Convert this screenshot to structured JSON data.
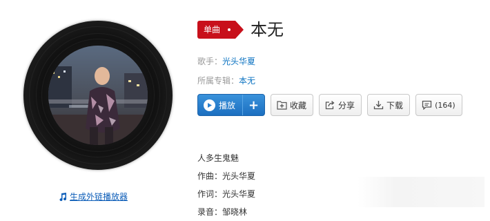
{
  "song": {
    "type_tag": "单曲",
    "title": "本无",
    "artist_label": "歌手：",
    "artist": "光头华夏",
    "album_label": "所属专辑：",
    "album": "本无"
  },
  "actions": {
    "play_label": "播放",
    "add_label": "+",
    "collect_label": "收藏",
    "share_label": "分享",
    "download_label": "下载",
    "comment_count": "(164)"
  },
  "cover": {
    "outlink_label": "生成外链播放器"
  },
  "lyrics": [
    "人多生鬼魅",
    "作曲：光头华夏",
    "作词：光头华夏",
    "录音：邹晓林"
  ],
  "colors": {
    "accent_red": "#c8101b",
    "link_blue": "#0c73c2",
    "play_blue": "#2a80cf"
  },
  "icons": {
    "outlink": "music-note-icon",
    "play": "play-circle-icon",
    "collect": "folder-plus-icon",
    "share": "share-icon",
    "download": "download-icon",
    "comment": "comment-icon"
  }
}
